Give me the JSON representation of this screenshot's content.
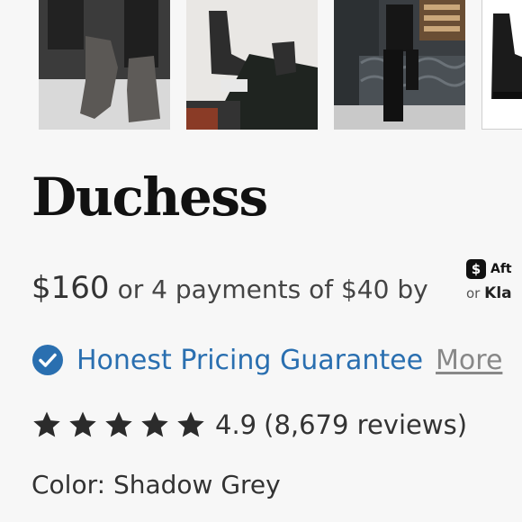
{
  "gallery": {
    "images": [
      {
        "alt": "grey boot on pavement"
      },
      {
        "alt": "seated legs in boots"
      },
      {
        "alt": "person leaning against storefront"
      },
      {
        "alt": "black boot side view"
      }
    ]
  },
  "product": {
    "title": "Duchess",
    "price": "$160",
    "installments": "or 4 payments of $40 by",
    "bnpl": {
      "afterpay_icon": "$",
      "afterpay_label": "Aft",
      "or_label": "or",
      "klarna_label": "Kla"
    },
    "guarantee": {
      "label": "Honest Pricing Guarantee",
      "more": "More",
      "icon": "check-badge-icon",
      "color": "#2a6fb0"
    },
    "rating": {
      "value": "4.9",
      "reviews": "(8,679 reviews)",
      "stars": 5
    },
    "color": {
      "label": "Color:",
      "value": "Shadow Grey"
    }
  }
}
